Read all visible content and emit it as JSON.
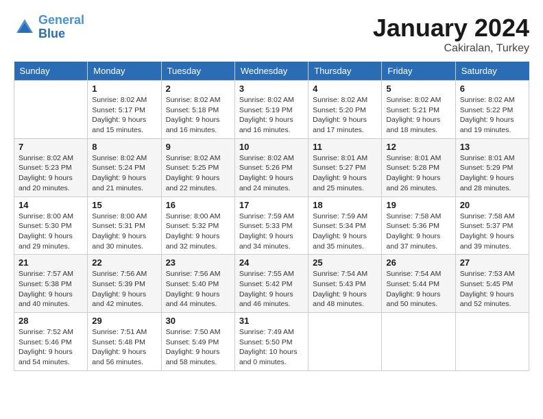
{
  "header": {
    "logo_line1": "General",
    "logo_line2": "Blue",
    "title": "January 2024",
    "subtitle": "Cakiralan, Turkey"
  },
  "days_of_week": [
    "Sunday",
    "Monday",
    "Tuesday",
    "Wednesday",
    "Thursday",
    "Friday",
    "Saturday"
  ],
  "weeks": [
    [
      {
        "day": "",
        "info": ""
      },
      {
        "day": "1",
        "info": "Sunrise: 8:02 AM\nSunset: 5:17 PM\nDaylight: 9 hours\nand 15 minutes."
      },
      {
        "day": "2",
        "info": "Sunrise: 8:02 AM\nSunset: 5:18 PM\nDaylight: 9 hours\nand 16 minutes."
      },
      {
        "day": "3",
        "info": "Sunrise: 8:02 AM\nSunset: 5:19 PM\nDaylight: 9 hours\nand 16 minutes."
      },
      {
        "day": "4",
        "info": "Sunrise: 8:02 AM\nSunset: 5:20 PM\nDaylight: 9 hours\nand 17 minutes."
      },
      {
        "day": "5",
        "info": "Sunrise: 8:02 AM\nSunset: 5:21 PM\nDaylight: 9 hours\nand 18 minutes."
      },
      {
        "day": "6",
        "info": "Sunrise: 8:02 AM\nSunset: 5:22 PM\nDaylight: 9 hours\nand 19 minutes."
      }
    ],
    [
      {
        "day": "7",
        "info": ""
      },
      {
        "day": "8",
        "info": "Sunrise: 8:02 AM\nSunset: 5:24 PM\nDaylight: 9 hours\nand 21 minutes."
      },
      {
        "day": "9",
        "info": "Sunrise: 8:02 AM\nSunset: 5:25 PM\nDaylight: 9 hours\nand 22 minutes."
      },
      {
        "day": "10",
        "info": "Sunrise: 8:02 AM\nSunset: 5:26 PM\nDaylight: 9 hours\nand 24 minutes."
      },
      {
        "day": "11",
        "info": "Sunrise: 8:01 AM\nSunset: 5:27 PM\nDaylight: 9 hours\nand 25 minutes."
      },
      {
        "day": "12",
        "info": "Sunrise: 8:01 AM\nSunset: 5:28 PM\nDaylight: 9 hours\nand 26 minutes."
      },
      {
        "day": "13",
        "info": "Sunrise: 8:01 AM\nSunset: 5:29 PM\nDaylight: 9 hours\nand 28 minutes."
      }
    ],
    [
      {
        "day": "14",
        "info": ""
      },
      {
        "day": "15",
        "info": "Sunrise: 8:00 AM\nSunset: 5:31 PM\nDaylight: 9 hours\nand 30 minutes."
      },
      {
        "day": "16",
        "info": "Sunrise: 8:00 AM\nSunset: 5:32 PM\nDaylight: 9 hours\nand 32 minutes."
      },
      {
        "day": "17",
        "info": "Sunrise: 7:59 AM\nSunset: 5:33 PM\nDaylight: 9 hours\nand 34 minutes."
      },
      {
        "day": "18",
        "info": "Sunrise: 7:59 AM\nSunset: 5:34 PM\nDaylight: 9 hours\nand 35 minutes."
      },
      {
        "day": "19",
        "info": "Sunrise: 7:58 AM\nSunset: 5:36 PM\nDaylight: 9 hours\nand 37 minutes."
      },
      {
        "day": "20",
        "info": "Sunrise: 7:58 AM\nSunset: 5:37 PM\nDaylight: 9 hours\nand 39 minutes."
      }
    ],
    [
      {
        "day": "21",
        "info": ""
      },
      {
        "day": "22",
        "info": "Sunrise: 7:56 AM\nSunset: 5:39 PM\nDaylight: 9 hours\nand 42 minutes."
      },
      {
        "day": "23",
        "info": "Sunrise: 7:56 AM\nSunset: 5:40 PM\nDaylight: 9 hours\nand 44 minutes."
      },
      {
        "day": "24",
        "info": "Sunrise: 7:55 AM\nSunset: 5:42 PM\nDaylight: 9 hours\nand 46 minutes."
      },
      {
        "day": "25",
        "info": "Sunrise: 7:54 AM\nSunset: 5:43 PM\nDaylight: 9 hours\nand 48 minutes."
      },
      {
        "day": "26",
        "info": "Sunrise: 7:54 AM\nSunset: 5:44 PM\nDaylight: 9 hours\nand 50 minutes."
      },
      {
        "day": "27",
        "info": "Sunrise: 7:53 AM\nSunset: 5:45 PM\nDaylight: 9 hours\nand 52 minutes."
      }
    ],
    [
      {
        "day": "28",
        "info": "Sunrise: 7:52 AM\nSunset: 5:46 PM\nDaylight: 9 hours\nand 54 minutes."
      },
      {
        "day": "29",
        "info": "Sunrise: 7:51 AM\nSunset: 5:48 PM\nDaylight: 9 hours\nand 56 minutes."
      },
      {
        "day": "30",
        "info": "Sunrise: 7:50 AM\nSunset: 5:49 PM\nDaylight: 9 hours\nand 58 minutes."
      },
      {
        "day": "31",
        "info": "Sunrise: 7:49 AM\nSunset: 5:50 PM\nDaylight: 10 hours\nand 0 minutes."
      },
      {
        "day": "",
        "info": ""
      },
      {
        "day": "",
        "info": ""
      },
      {
        "day": "",
        "info": ""
      }
    ]
  ],
  "week7_sunday": {
    "day": "7",
    "info": "Sunrise: 8:02 AM\nSunset: 5:23 PM\nDaylight: 9 hours\nand 20 minutes."
  },
  "week14_sunday": {
    "day": "14",
    "info": "Sunrise: 8:00 AM\nSunset: 5:30 PM\nDaylight: 9 hours\nand 29 minutes."
  },
  "week21_sunday": {
    "day": "21",
    "info": "Sunrise: 7:57 AM\nSunset: 5:38 PM\nDaylight: 9 hours\nand 40 minutes."
  }
}
